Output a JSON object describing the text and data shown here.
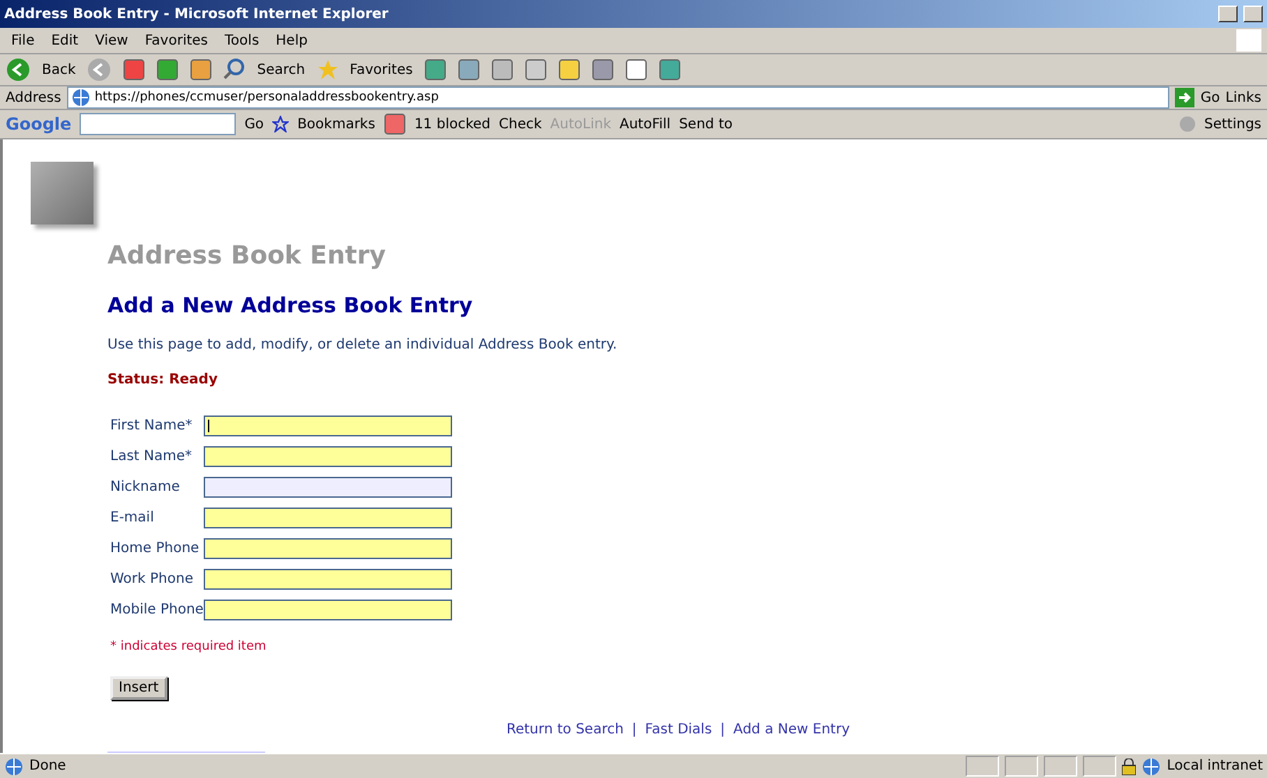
{
  "window": {
    "title": "Address Book Entry - Microsoft Internet Explorer"
  },
  "menu": [
    "File",
    "Edit",
    "View",
    "Favorites",
    "Tools",
    "Help"
  ],
  "toolbar": {
    "back": "Back",
    "search": "Search",
    "favorites": "Favorites"
  },
  "address_bar": {
    "label": "Address",
    "url": "https://phones/ccmuser/personaladdressbookentry.asp",
    "go": "Go",
    "links": "Links"
  },
  "google_bar": {
    "logo": "Google",
    "go": "Go",
    "bookmarks": "Bookmarks",
    "blocked": "11 blocked",
    "check": "Check",
    "autolink": "AutoLink",
    "autofill": "AutoFill",
    "send_to": "Send to",
    "settings": "Settings"
  },
  "page": {
    "heading": "Address Book Entry",
    "subheading": "Add a New Address Book Entry",
    "description": "Use this page to add, modify, or delete an individual Address Book entry.",
    "status": "Status: Ready",
    "fields": [
      {
        "label": "First Name*",
        "highlighted": true,
        "focused": true
      },
      {
        "label": "Last Name*",
        "highlighted": true,
        "focused": false
      },
      {
        "label": "Nickname",
        "highlighted": false,
        "focused": false
      },
      {
        "label": "E-mail",
        "highlighted": true,
        "focused": false
      },
      {
        "label": "Home Phone",
        "highlighted": true,
        "focused": false
      },
      {
        "label": "Work Phone",
        "highlighted": true,
        "focused": false
      },
      {
        "label": "Mobile Phone",
        "highlighted": true,
        "focused": false
      }
    ],
    "required_note": "* indicates required item",
    "insert_button": "Insert",
    "links": [
      "Return to Search",
      "Fast Dials",
      "Add a New Entry"
    ],
    "separator": "|"
  },
  "status_bar": {
    "text": "Done",
    "zone": "Local intranet"
  }
}
